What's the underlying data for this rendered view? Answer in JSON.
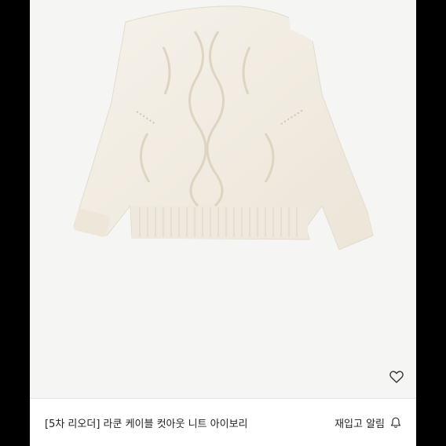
{
  "product": {
    "name": "[5차 리오더] 라쿤 케이블 컷아웃 니트 아이보리",
    "restock_label": "재입고 알림",
    "image_alt": "ivory cable knit sweater"
  },
  "icons": {
    "wishlist": "heart-icon",
    "restock": "bell-icon"
  },
  "colors": {
    "background": "#000000",
    "card": "#ffffff",
    "photo_bg": "#f5f5f4",
    "sweater": "#f3eee4",
    "text": "#222222"
  }
}
